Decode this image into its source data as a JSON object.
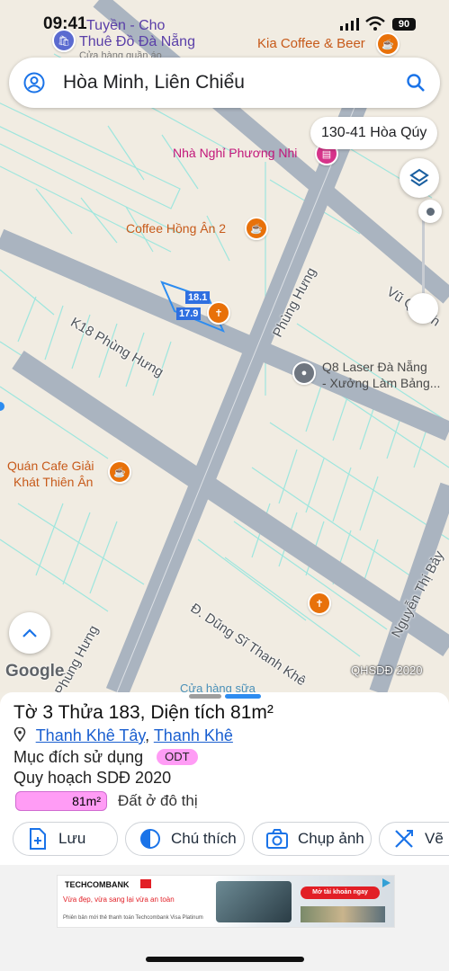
{
  "status_bar": {
    "time": "09:41",
    "battery": "90"
  },
  "search": {
    "query": "Hòa Minh, Liên Chiểu"
  },
  "map": {
    "address_chip": "130-41 Hòa Qúy",
    "pois": {
      "top_left": {
        "line1": "Tuyền - Cho",
        "line2": "Thuê Đồ Đà Nẵng",
        "line3": "Cửa hàng quần áo"
      },
      "kia": "Kia Coffee & Beer",
      "phuong_nhi": "Nhà Nghỉ Phương Nhi",
      "hong_an": "Coffee Hồng Ân 2",
      "q8": {
        "line1": "Q8 Laser Đà Nẵng",
        "line2": "- Xưởng Làm Bảng..."
      },
      "giai_khat": {
        "line1": "Quán Cafe Giải",
        "line2": "Khát Thiên Ân"
      },
      "bottom_store": "Cửa hàng sữa"
    },
    "roads": {
      "k18": "K18 Phùng Hưng",
      "phung_hung": "Phùng Hưng",
      "vu": "Vũ Quỳnh",
      "dung_si": "Đ. Dũng Sĩ Thanh Khê",
      "nguyen_thi": "Nguyễn Thị Bảy",
      "phung_hung_bottom": "Phùng Hưng"
    },
    "plot_labels": [
      "18.1",
      "17.9"
    ],
    "google_logo": "Google",
    "layer_watermark": "QHSDĐ 2020"
  },
  "sheet": {
    "title": "Tờ 3 Thửa 183, Diện tích 81m²",
    "ward": "Thanh Khê Tây",
    "district": "Thanh Khê",
    "separator": ",",
    "purpose_label": "Mục đích sử dụng",
    "purpose_code": "ODT",
    "plan_label": "Quy hoạch SDĐ 2020",
    "plan_area": "81m²",
    "plan_land_type": "Đất ở đô thị",
    "plan_fill_fraction": 1.0
  },
  "actions": [
    "Lưu",
    "Chú thích",
    "Chụp ảnh",
    "Vẽ"
  ],
  "ad": {
    "brand": "TECHCOMBANK",
    "headline": "Vừa đẹp, vừa sang lại vừa an toàn",
    "subline": "Phiên bản mới thẻ thanh toán Techcombank Visa Platinum",
    "cta": "Mở tài khoản ngay"
  },
  "colors": {
    "accent": "#2d8cf0",
    "odt": "#ff9cf5",
    "link": "#1a5fd0"
  }
}
